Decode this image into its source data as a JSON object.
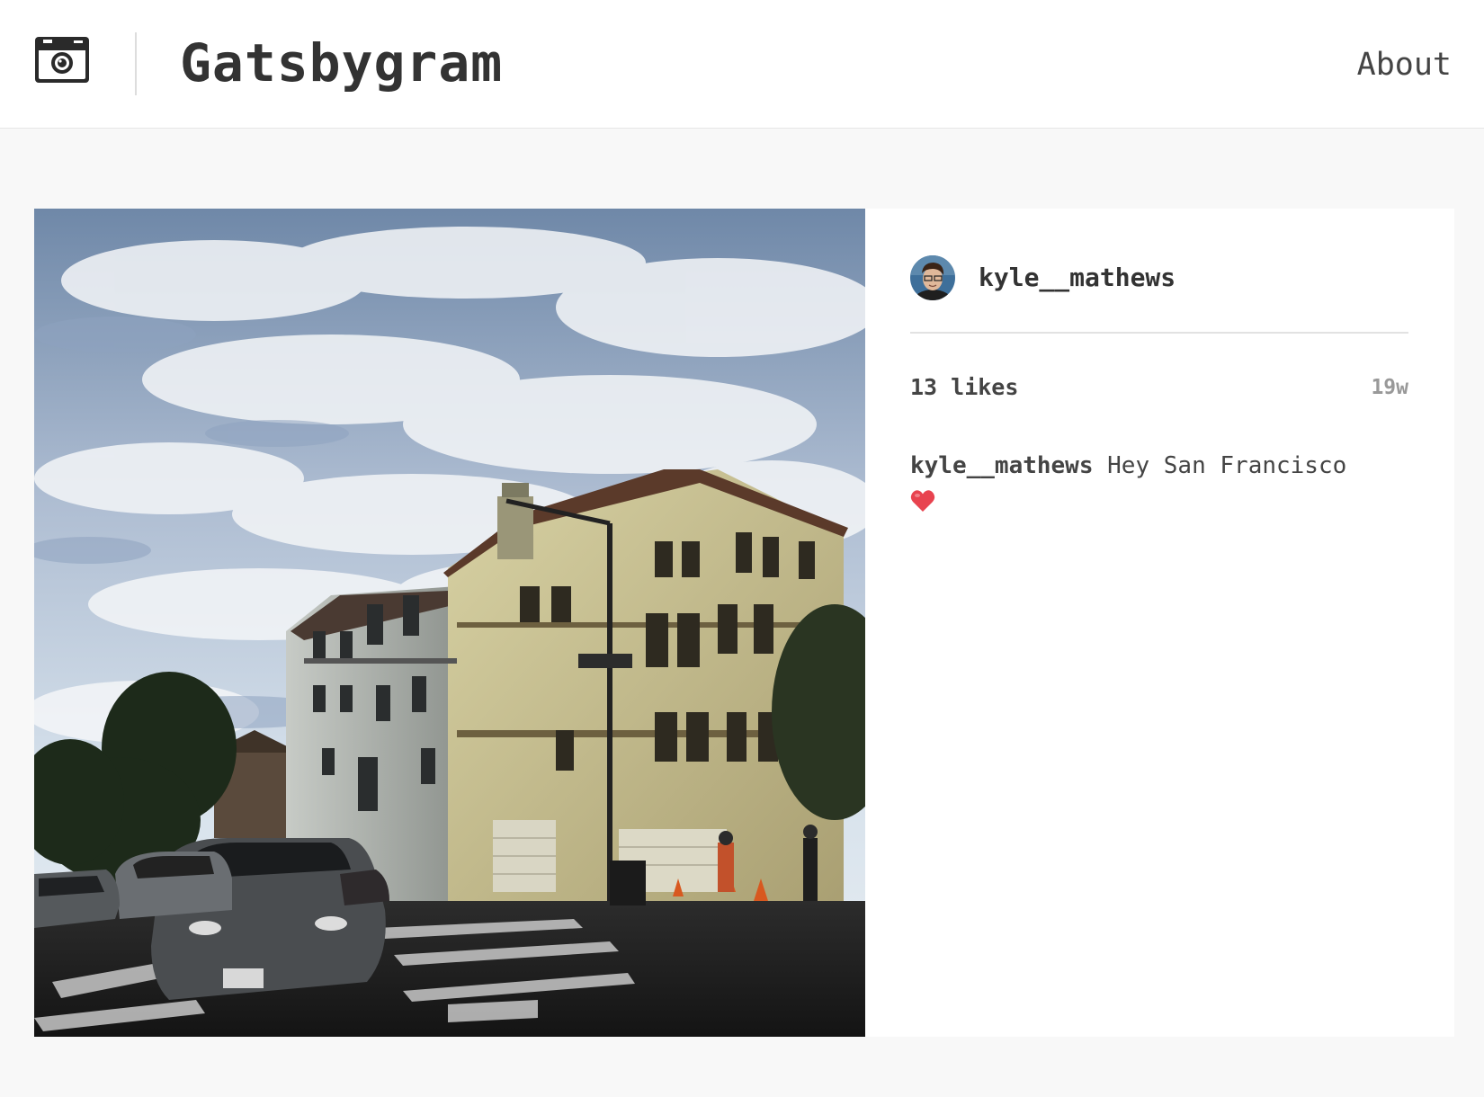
{
  "header": {
    "brand": "Gatsbygram",
    "logo_icon": "camera-icon",
    "nav_about": "About"
  },
  "post": {
    "image_icon": "photo-san-francisco-building",
    "username": "kyle__mathews",
    "avatar_icon": "user-avatar",
    "likes": "13 likes",
    "time_ago": "19w",
    "caption_user": "kyle__mathews",
    "caption_text": "Hey San Francisco",
    "caption_emoji_icon": "heart-icon",
    "colors": {
      "heart": "#e8434f",
      "text": "#333333",
      "muted": "#999999"
    }
  }
}
